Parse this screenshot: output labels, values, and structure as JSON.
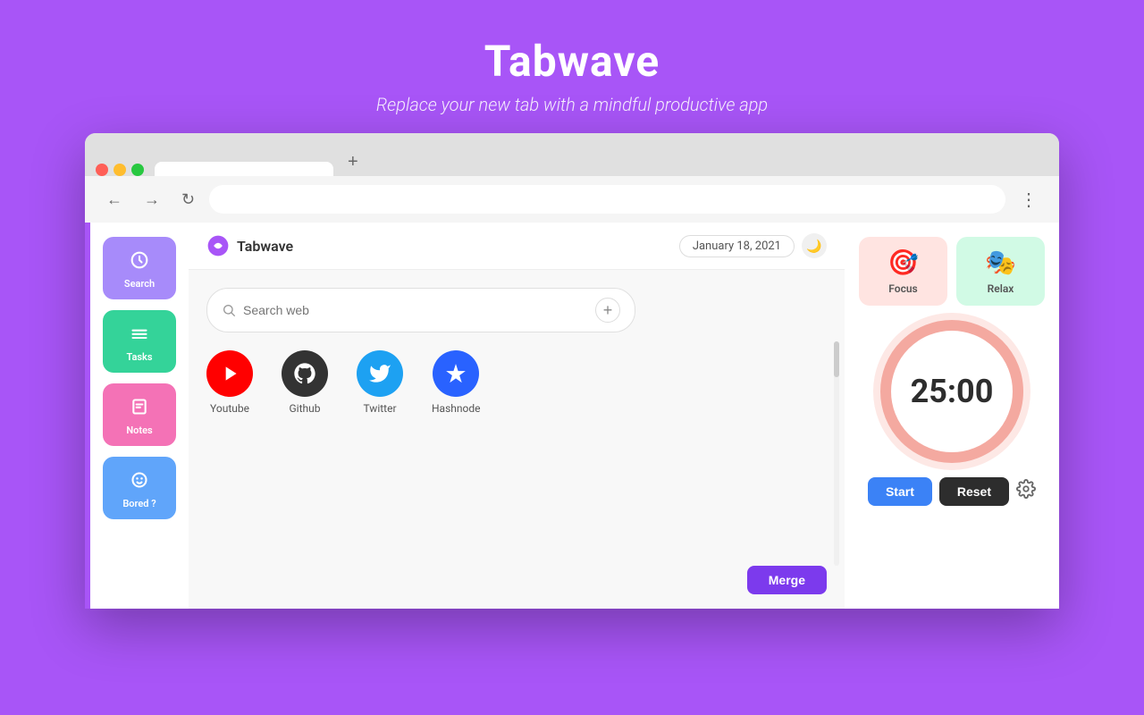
{
  "hero": {
    "title": "Tabwave",
    "subtitle": "Replace your new tab with a mindful productive app"
  },
  "browser": {
    "tab_label": "",
    "new_tab_btn": "+",
    "back_btn": "←",
    "forward_btn": "→",
    "reload_btn": "↻",
    "menu_btn": "⋮",
    "address": ""
  },
  "app": {
    "logo_text": "Tabwave",
    "date": "January 18, 2021",
    "theme_icon": "🌙"
  },
  "nav": {
    "items": [
      {
        "id": "search",
        "label": "Search",
        "color": "#a78bfa"
      },
      {
        "id": "tasks",
        "label": "Tasks",
        "color": "#34d399"
      },
      {
        "id": "notes",
        "label": "Notes",
        "color": "#f472b6"
      },
      {
        "id": "bored",
        "label": "Bored ?",
        "color": "#60a5fa"
      }
    ]
  },
  "search": {
    "placeholder": "Search web",
    "add_btn": "+"
  },
  "shortcuts": [
    {
      "id": "youtube",
      "label": "Youtube",
      "color": "#ff0000",
      "icon": "▶"
    },
    {
      "id": "github",
      "label": "Github",
      "color": "#333",
      "icon": ""
    },
    {
      "id": "twitter",
      "label": "Twitter",
      "color": "#1da1f2",
      "icon": "🐦"
    },
    {
      "id": "hashnode",
      "label": "Hashnode",
      "color": "#2962ff",
      "icon": "◆"
    }
  ],
  "modes": [
    {
      "id": "focus",
      "label": "Focus",
      "color_bg": "#ffe4e1",
      "icon": "🎯"
    },
    {
      "id": "relax",
      "label": "Relax",
      "color_bg": "#d1fae5",
      "icon": "🎭"
    }
  ],
  "timer": {
    "display": "25:00",
    "start_label": "Start",
    "reset_label": "Reset"
  },
  "merge_btn": "Merge"
}
